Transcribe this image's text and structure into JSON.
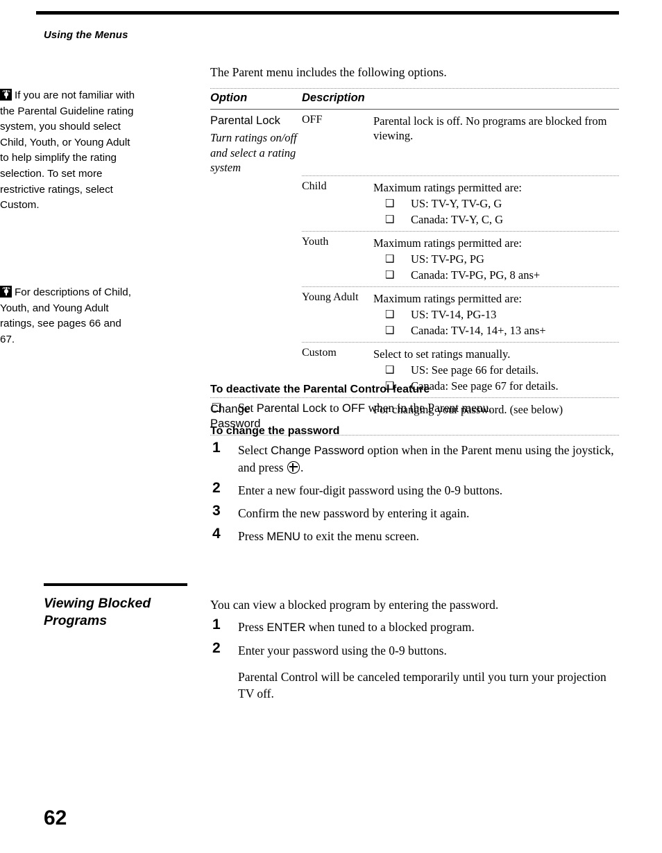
{
  "running_head": "Using the Menus",
  "notes": [
    {
      "icon": "tip-lightbulb-icon",
      "text": "If you are not familiar with the Parental Guideline rating system, you should select Child, Youth, or Young Adult to help simplify the rating selection. To set more restrictive ratings, select Custom."
    },
    {
      "icon": "tip-lightbulb-icon",
      "text": "For descriptions of Child, Youth, and Young Adult ratings, see pages 66 and 67."
    }
  ],
  "intro": "The Parent menu includes the following options.",
  "table": {
    "headers": {
      "option": "Option",
      "description": "Description"
    },
    "rows": [
      {
        "option": "Parental Lock",
        "option_sub": "Turn ratings on/off and select a rating system",
        "values": [
          {
            "value": "OFF",
            "desc": "Parental lock is off. No programs are blocked from viewing.",
            "bullets": []
          },
          {
            "value": "Child",
            "desc": "Maximum ratings permitted are:",
            "bullets": [
              "US: TV-Y, TV-G, G",
              "Canada: TV-Y, C, G"
            ]
          },
          {
            "value": "Youth",
            "desc": "Maximum ratings permitted are:",
            "bullets": [
              "US: TV-PG, PG",
              "Canada: TV-PG, PG, 8 ans+"
            ]
          },
          {
            "value": "Young Adult",
            "desc": "Maximum ratings permitted are:",
            "bullets": [
              "US: TV-14, PG-13",
              "Canada: TV-14, 14+, 13 ans+"
            ]
          },
          {
            "value": "Custom",
            "desc": "Select to set ratings manually.",
            "bullets": [
              "US: See page 66 for details.",
              "Canada: See page 67 for details."
            ]
          }
        ]
      },
      {
        "option": "Change Password",
        "option_sub": "",
        "values": [
          {
            "value": "",
            "desc": "For changing your password. (see below)",
            "bullets": []
          }
        ]
      }
    ]
  },
  "deactivate": {
    "heading": "To deactivate the Parental Control feature",
    "bullet_symbol": "❑",
    "item_pre": "Set ",
    "item_term1": "Parental Lock",
    "item_mid": " to ",
    "item_term2": "OFF",
    "item_post": " when in the Parent menu."
  },
  "change_password": {
    "heading": "To change the password",
    "steps": [
      {
        "num": "1",
        "pre": "Select ",
        "term": "Change Password",
        "mid": " option when in the Parent menu using the joystick, and press ",
        "icon": "joystick-select-icon",
        "post": "."
      },
      {
        "num": "2",
        "pre": "Enter a new four-digit password using the 0-9 buttons.",
        "term": "",
        "mid": "",
        "post": ""
      },
      {
        "num": "3",
        "pre": "Confirm the new password by entering it again.",
        "term": "",
        "mid": "",
        "post": ""
      },
      {
        "num": "4",
        "pre": "Press ",
        "term": "MENU",
        "mid": " to exit the menu screen.",
        "post": ""
      }
    ]
  },
  "viewing_blocked": {
    "heading": "Viewing Blocked Programs",
    "intro": "You can view a blocked program by entering the password.",
    "steps": [
      {
        "num": "1",
        "pre": "Press ",
        "term": "ENTER",
        "mid": " when tuned to a blocked program.",
        "post": ""
      },
      {
        "num": "2",
        "pre": "Enter your password using the 0-9 buttons.",
        "term": "",
        "mid": "",
        "post": ""
      }
    ],
    "note": "Parental Control will be canceled temporarily until you turn your projection TV off."
  },
  "folio": "62"
}
